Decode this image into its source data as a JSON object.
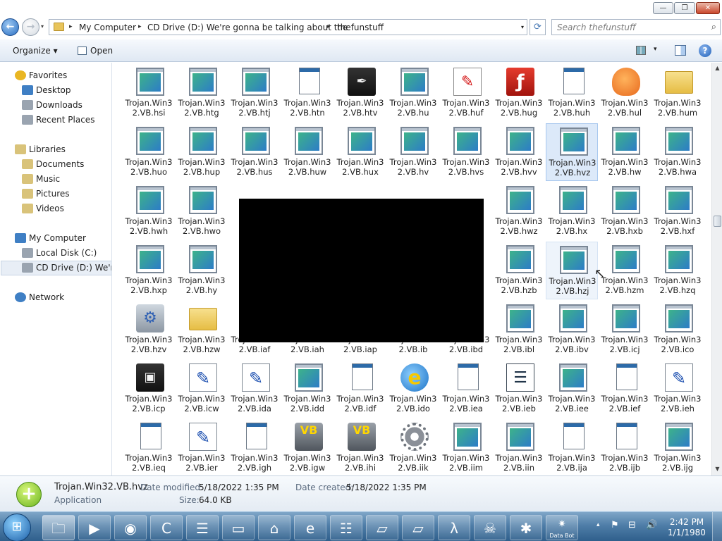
{
  "window": {
    "minimize_glyph": "—",
    "maximize_glyph": "❐",
    "close_glyph": "✕"
  },
  "address": {
    "crumbs": [
      "My Computer",
      "CD Drive (D:) We're gonna be talking about the",
      "thefunstuff"
    ],
    "separator": "▸",
    "search_placeholder": "Search thefunstuff"
  },
  "toolbar": {
    "organize_label": "Organize",
    "open_label": "Open",
    "dropdown_glyph": "▾",
    "help_glyph": "?"
  },
  "nav": {
    "items": [
      {
        "label": "Favorites",
        "icon": "star-icon"
      },
      {
        "label": "Desktop",
        "icon": "desktop-icon"
      },
      {
        "label": "Downloads",
        "icon": "downloads-icon"
      },
      {
        "label": "Recent Places",
        "icon": "recent-places-icon"
      },
      {
        "label": "Libraries",
        "icon": "libraries-icon"
      },
      {
        "label": "Documents",
        "icon": "documents-icon"
      },
      {
        "label": "Music",
        "icon": "music-icon"
      },
      {
        "label": "Pictures",
        "icon": "pictures-icon"
      },
      {
        "label": "Videos",
        "icon": "videos-icon"
      },
      {
        "label": "My Computer",
        "icon": "computer-icon"
      },
      {
        "label": "Local Disk (C:)",
        "icon": "hard-disk-icon"
      },
      {
        "label": "CD Drive (D:) We're gonna be talking about the",
        "icon": "cd-drive-icon"
      },
      {
        "label": "Network",
        "icon": "network-icon"
      }
    ]
  },
  "files": [
    {
      "label": "Trojan.Win32.VB.hsi",
      "icon": "exe"
    },
    {
      "label": "Trojan.Win32.VB.htg",
      "icon": "exe"
    },
    {
      "label": "Trojan.Win32.VB.htj",
      "icon": "exe"
    },
    {
      "label": "Trojan.Win32.VB.htn",
      "icon": "generic"
    },
    {
      "label": "Trojan.Win32.VB.htv",
      "icon": "pen-tool"
    },
    {
      "label": "Trojan.Win32.VB.hu",
      "icon": "exe"
    },
    {
      "label": "Trojan.Win32.VB.huf",
      "icon": "paint"
    },
    {
      "label": "Trojan.Win32.VB.hug",
      "icon": "flash"
    },
    {
      "label": "Trojan.Win32.VB.huh",
      "icon": "generic"
    },
    {
      "label": "Trojan.Win32.VB.hul",
      "icon": "character"
    },
    {
      "label": "Trojan.Win32.VB.hum",
      "icon": "folder"
    },
    {
      "label": "Trojan.Win32.VB.huo",
      "icon": "exe"
    },
    {
      "label": "Trojan.Win32.VB.hup",
      "icon": "exe"
    },
    {
      "label": "Trojan.Win32.VB.hus",
      "icon": "exe"
    },
    {
      "label": "Trojan.Win32.VB.huw",
      "icon": "exe"
    },
    {
      "label": "Trojan.Win32.VB.hux",
      "icon": "exe"
    },
    {
      "label": "Trojan.Win32.VB.hv",
      "icon": "exe"
    },
    {
      "label": "Trojan.Win32.VB.hvs",
      "icon": "exe"
    },
    {
      "label": "Trojan.Win32.VB.hvv",
      "icon": "exe"
    },
    {
      "label": "Trojan.Win32.VB.hvz",
      "icon": "exe",
      "selected": true
    },
    {
      "label": "Trojan.Win32.VB.hw",
      "icon": "exe"
    },
    {
      "label": "Trojan.Win32.VB.hwa",
      "icon": "exe"
    },
    {
      "label": "Trojan.Win32.VB.hwh",
      "icon": "exe"
    },
    {
      "label": "Trojan.Win32.VB.hwo",
      "icon": "exe"
    },
    {
      "label": "Trojan.Win32.VB.hwz",
      "icon": "exe"
    },
    {
      "label": "Trojan.Win32.VB.hx",
      "icon": "exe"
    },
    {
      "label": "Trojan.Win32.VB.hxb",
      "icon": "exe"
    },
    {
      "label": "Trojan.Win32.VB.hxf",
      "icon": "exe"
    },
    {
      "label": "Trojan.Win32.VB.hxp",
      "icon": "exe"
    },
    {
      "label": "Trojan.Win32.VB.hy",
      "icon": "exe"
    },
    {
      "label": "Trojan.Win32.VB.hzb",
      "icon": "exe"
    },
    {
      "label": "Trojan.Win32.VB.hzj",
      "icon": "exe",
      "hovered": true
    },
    {
      "label": "Trojan.Win32.VB.hzm",
      "icon": "exe"
    },
    {
      "label": "Trojan.Win32.VB.hzq",
      "icon": "exe"
    },
    {
      "label": "Trojan.Win32.VB.hzv",
      "icon": "shield-setup"
    },
    {
      "label": "Trojan.Win32.VB.hzw",
      "icon": "folder"
    },
    {
      "label": "Trojan.Win32.VB.iaf",
      "icon": "exe"
    },
    {
      "label": "Trojan.Win32.VB.iah",
      "icon": "exe"
    },
    {
      "label": "Trojan.Win32.VB.iap",
      "icon": "exe"
    },
    {
      "label": "Trojan.Win32.VB.ib",
      "icon": "exe"
    },
    {
      "label": "Trojan.Win32.VB.ibd",
      "icon": "exe"
    },
    {
      "label": "Trojan.Win32.VB.ibl",
      "icon": "exe"
    },
    {
      "label": "Trojan.Win32.VB.ibv",
      "icon": "exe"
    },
    {
      "label": "Trojan.Win32.VB.icj",
      "icon": "exe"
    },
    {
      "label": "Trojan.Win32.VB.ico",
      "icon": "exe"
    },
    {
      "label": "Trojan.Win32.VB.icp",
      "icon": "setup"
    },
    {
      "label": "Trojan.Win32.VB.icw",
      "icon": "document-pen"
    },
    {
      "label": "Trojan.Win32.VB.ida",
      "icon": "document-pen"
    },
    {
      "label": "Trojan.Win32.VB.idd",
      "icon": "exe"
    },
    {
      "label": "Trojan.Win32.VB.idf",
      "icon": "generic"
    },
    {
      "label": "Trojan.Win32.VB.ido",
      "icon": "internet-explorer"
    },
    {
      "label": "Trojan.Win32.VB.iea",
      "icon": "generic"
    },
    {
      "label": "Trojan.Win32.VB.ieb",
      "icon": "sheets"
    },
    {
      "label": "Trojan.Win32.VB.iee",
      "icon": "exe"
    },
    {
      "label": "Trojan.Win32.VB.ief",
      "icon": "generic"
    },
    {
      "label": "Trojan.Win32.VB.ieh",
      "icon": "document-pen"
    },
    {
      "label": "Trojan.Win32.VB.ieq",
      "icon": "generic"
    },
    {
      "label": "Trojan.Win32.VB.ier",
      "icon": "document-pen"
    },
    {
      "label": "Trojan.Win32.VB.igh",
      "icon": "generic"
    },
    {
      "label": "Trojan.Win32.VB.igw",
      "icon": "video-camera"
    },
    {
      "label": "Trojan.Win32.VB.ihi",
      "icon": "video-camera"
    },
    {
      "label": "Trojan.Win32.VB.iik",
      "icon": "gear"
    },
    {
      "label": "Trojan.Win32.VB.iim",
      "icon": "exe"
    },
    {
      "label": "Trojan.Win32.VB.iin",
      "icon": "exe"
    },
    {
      "label": "Trojan.Win32.VB.ija",
      "icon": "generic"
    },
    {
      "label": "Trojan.Win32.VB.ijb",
      "icon": "generic"
    },
    {
      "label": "Trojan.Win32.VB.ijg",
      "icon": "exe"
    }
  ],
  "details": {
    "name": "Trojan.Win32.VB.hvz",
    "type": "Application",
    "modified_key": "Date modified:",
    "modified_val": "5/18/2022 1:35 PM",
    "created_key": "Date created:",
    "created_val": "5/18/2022 1:35 PM",
    "size_key": "Size:",
    "size_val": "64.0 KB"
  },
  "taskbar": {
    "start_glyph": "⊞",
    "buttons": [
      {
        "name": "explorer-taskbar-button",
        "glyph": "🗀",
        "active": true
      },
      {
        "name": "media-player-taskbar-button",
        "glyph": "▶"
      },
      {
        "name": "chrome-taskbar-button",
        "glyph": "◉"
      },
      {
        "name": "ccleaner-taskbar-button",
        "glyph": "C"
      },
      {
        "name": "notepad-taskbar-button",
        "glyph": "☰"
      },
      {
        "name": "window-taskbar-button",
        "glyph": "▭"
      },
      {
        "name": "home-taskbar-button",
        "glyph": "⌂"
      },
      {
        "name": "ie-taskbar-button",
        "glyph": "e"
      },
      {
        "name": "list-taskbar-button",
        "glyph": "☷"
      },
      {
        "name": "file-taskbar-button",
        "glyph": "▱"
      },
      {
        "name": "file2-taskbar-button",
        "glyph": "▱"
      },
      {
        "name": "halflife-taskbar-button",
        "glyph": "λ"
      },
      {
        "name": "skull-taskbar-button",
        "glyph": "☠"
      },
      {
        "name": "red-app-taskbar-button",
        "glyph": "✱"
      },
      {
        "name": "data-bot-taskbar-button",
        "glyph": "✷",
        "caption": "Data Bot"
      }
    ],
    "tray_up": "▴",
    "tray_icons": [
      "⚑",
      "⊟",
      "🔊"
    ],
    "time": "2:42 PM",
    "date": "1/1/1980"
  }
}
